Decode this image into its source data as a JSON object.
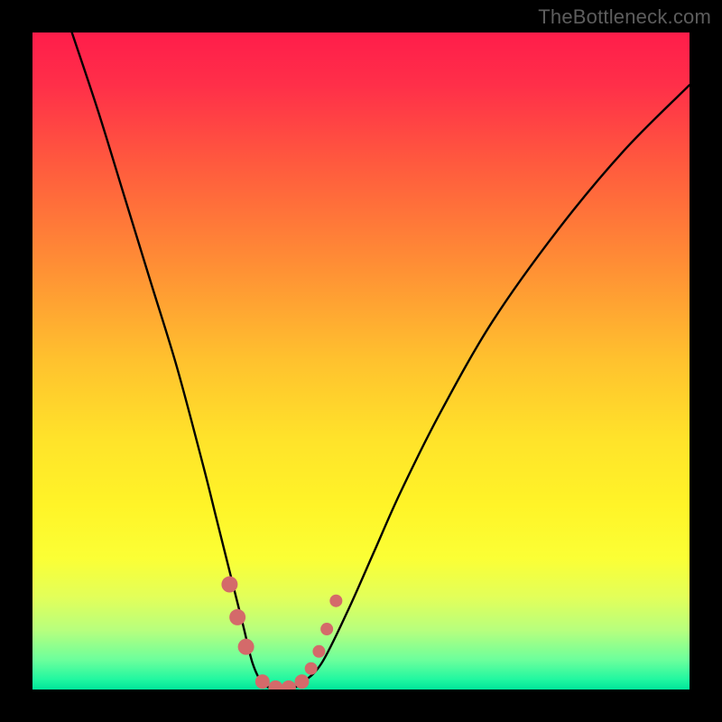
{
  "watermark": "TheBottleneck.com",
  "chart_data": {
    "type": "line",
    "title": "",
    "xlabel": "",
    "ylabel": "",
    "xlim": [
      0,
      100
    ],
    "ylim": [
      0,
      100
    ],
    "series": [
      {
        "name": "curve",
        "x": [
          6,
          10,
          14,
          18,
          22,
          26,
          28,
          30,
          32,
          33.5,
          35,
          37,
          39,
          41,
          44,
          48,
          52,
          56,
          62,
          70,
          80,
          90,
          100
        ],
        "y": [
          100,
          88,
          75,
          62,
          49,
          34,
          26,
          18,
          10,
          4,
          1,
          0,
          0,
          1,
          4,
          12,
          21,
          30,
          42,
          56,
          70,
          82,
          92
        ]
      }
    ],
    "markers": {
      "name": "highlight-points",
      "x": [
        30.0,
        31.2,
        32.5,
        35,
        37,
        39,
        41,
        42.4,
        43.6,
        44.8,
        46.2
      ],
      "y": [
        16,
        11,
        6.5,
        1.2,
        0.3,
        0.3,
        1.2,
        3.2,
        5.8,
        9.2,
        13.5
      ],
      "size": [
        18,
        18,
        18,
        16,
        16,
        16,
        16,
        14,
        14,
        14,
        14
      ]
    },
    "gradient_stops": [
      {
        "offset": 0.0,
        "color": "#ff1d4a"
      },
      {
        "offset": 0.08,
        "color": "#ff2f49"
      },
      {
        "offset": 0.2,
        "color": "#ff5a3e"
      },
      {
        "offset": 0.35,
        "color": "#ff8d35"
      },
      {
        "offset": 0.5,
        "color": "#ffc22e"
      },
      {
        "offset": 0.62,
        "color": "#ffe32a"
      },
      {
        "offset": 0.72,
        "color": "#fff428"
      },
      {
        "offset": 0.8,
        "color": "#fbff35"
      },
      {
        "offset": 0.86,
        "color": "#e2ff5a"
      },
      {
        "offset": 0.91,
        "color": "#b7ff7e"
      },
      {
        "offset": 0.955,
        "color": "#6cff9c"
      },
      {
        "offset": 0.985,
        "color": "#20f7a0"
      },
      {
        "offset": 1.0,
        "color": "#00e59a"
      }
    ],
    "marker_color": "#d46a6a",
    "curve_color": "#000000"
  }
}
